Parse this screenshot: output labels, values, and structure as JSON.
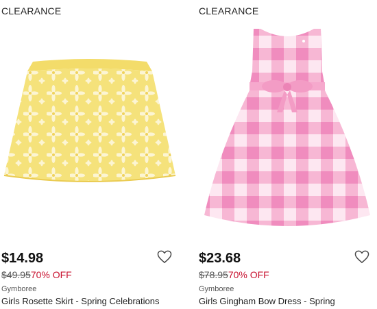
{
  "products": [
    {
      "badge": "CLEARANCE",
      "price": "$14.98",
      "original_price": "$49.95",
      "discount": "70% OFF",
      "brand": "Gymboree",
      "name": "Girls Rosette Skirt - Spring Celebrations",
      "image": "yellow-floral-skirt"
    },
    {
      "badge": "CLEARANCE",
      "price": "$23.68",
      "original_price": "$78.95",
      "discount": "70% OFF",
      "brand": "Gymboree",
      "name": "Girls Gingham Bow Dress - Spring",
      "image": "pink-gingham-dress"
    }
  ],
  "colors": {
    "discount": "#c8102e",
    "skirt": "#f4e27a",
    "gingham_pink": "#f4a6cc",
    "gingham_light": "#fbd9ea"
  },
  "icons": {
    "favorite": "heart-outline-icon"
  }
}
